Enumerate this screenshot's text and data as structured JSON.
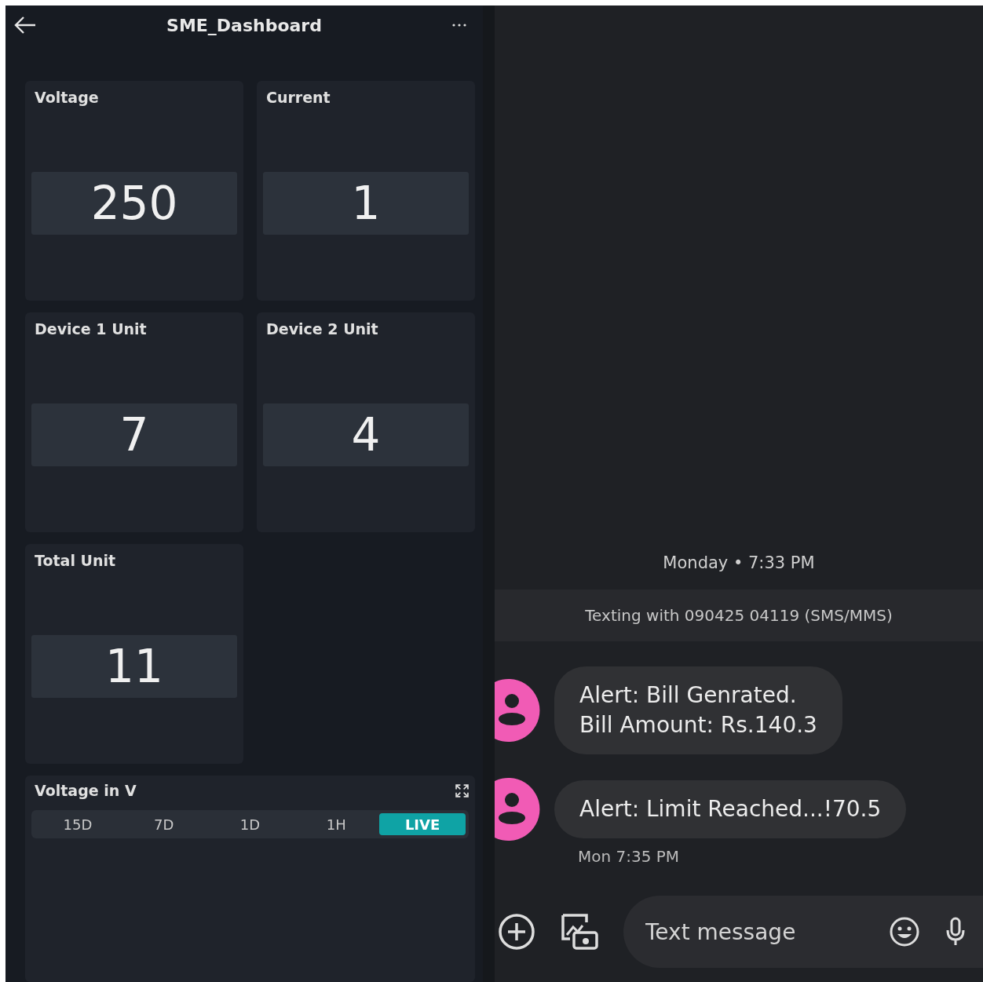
{
  "dashboard": {
    "title": "SME_Dashboard",
    "tiles": [
      {
        "label": "Voltage",
        "value": "250"
      },
      {
        "label": "Current",
        "value": "1"
      },
      {
        "label": "Device 1 Unit",
        "value": "7"
      },
      {
        "label": "Device 2 Unit",
        "value": "4"
      },
      {
        "label": "Total Unit",
        "value": "11"
      }
    ],
    "chart": {
      "title": "Voltage in V",
      "periods": [
        {
          "label": "15D",
          "selected": false
        },
        {
          "label": "7D",
          "selected": false
        },
        {
          "label": "1D",
          "selected": false
        },
        {
          "label": "1H",
          "selected": false
        },
        {
          "label": "LIVE",
          "selected": true
        }
      ]
    }
  },
  "messages": {
    "date": "Monday • 7:33 PM",
    "banner": "Texting with 090425 04119 (SMS/MMS)",
    "items": [
      {
        "lines": [
          "Alert: Bill Genrated.",
          "Bill Amount: Rs.140.3"
        ]
      },
      {
        "lines": [
          "Alert: Limit Reached...!70.5"
        ]
      }
    ],
    "time": "Mon 7:35 PM",
    "compose": {
      "placeholder": "Text message"
    }
  }
}
